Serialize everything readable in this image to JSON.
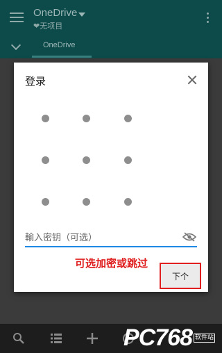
{
  "app": {
    "title": "OneDrive",
    "subtitle": "❤无项目",
    "tab": "OneDrive"
  },
  "dialog": {
    "title": "登录",
    "pattern_dot_count": 9,
    "password_placeholder": "輸入密钥（可选）",
    "annotation": "可选加密或跳过",
    "next_label": "下个"
  },
  "bottombar": {
    "icons": [
      "search-icon",
      "list-view-icon",
      "add-icon",
      "camera-icon",
      "tags-icon"
    ]
  },
  "watermark": {
    "brand": "PC768",
    "small": "软件站"
  },
  "colors": {
    "appbar": "#0d4a4a",
    "accent_blue": "#1e88e5",
    "annotation_red": "#e02020"
  }
}
